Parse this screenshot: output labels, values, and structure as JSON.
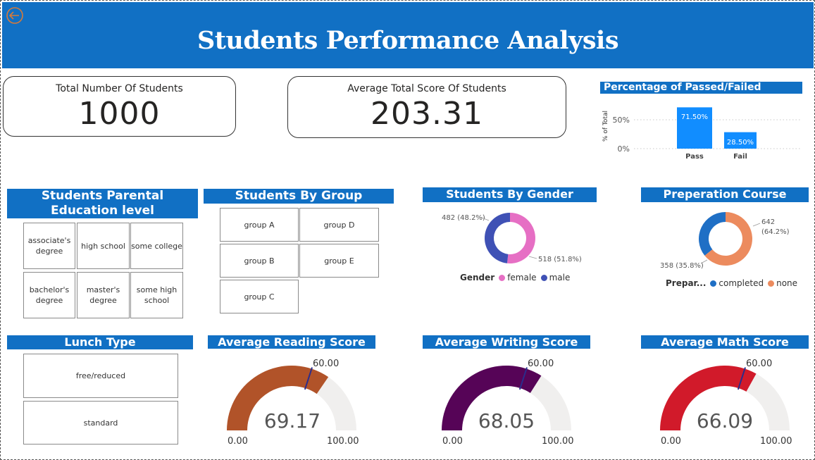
{
  "header": {
    "title": "Students Performance Analysis",
    "back_icon": "back-arrow-icon"
  },
  "kpis": {
    "total_students": {
      "label": "Total Number Of Students",
      "value": "1000"
    },
    "avg_total_score": {
      "label": "Average Total Score Of Students",
      "value": "203.31"
    }
  },
  "pass_fail": {
    "title": "Percentage of Passed/Failed Students",
    "y_axis_label": "% of Total",
    "y_ticks": [
      "50%",
      "0%"
    ],
    "bars": [
      {
        "category": "Pass",
        "label": "71.50%"
      },
      {
        "category": "Fail",
        "label": "28.50%"
      }
    ]
  },
  "parental_education": {
    "title": "Students Parental Education level",
    "items": [
      "associate's degree",
      "high school",
      "some college",
      "bachelor's degree",
      "master's degree",
      "some high school"
    ]
  },
  "groups": {
    "title": "Students By Group",
    "items": [
      "group A",
      "group D",
      "group B",
      "group E",
      "group C"
    ]
  },
  "gender": {
    "title": "Students By Gender",
    "legend_title": "Gender",
    "labels": {
      "male": "482 (48.2%)",
      "female": "518 (51.8%)"
    },
    "legend": [
      "female",
      "male"
    ]
  },
  "prep": {
    "title": "Preperation Course",
    "legend_title": "Prepar...",
    "labels": {
      "none_line1": "642",
      "none_line2": "(64.2%)",
      "completed": "358 (35.8%)"
    },
    "legend": [
      "completed",
      "none"
    ]
  },
  "lunch": {
    "title": "Lunch Type",
    "items": [
      "free/reduced",
      "standard"
    ]
  },
  "gauges": {
    "reading": {
      "title": "Average Reading Score",
      "value": "69.17",
      "target": "60.00",
      "min": "0.00",
      "max": "100.00"
    },
    "writing": {
      "title": "Average Writing Score",
      "value": "68.05",
      "target": "60.00",
      "min": "0.00",
      "max": "100.00"
    },
    "math": {
      "title": "Average Math Score",
      "value": "66.09",
      "target": "60.00",
      "min": "0.00",
      "max": "100.00"
    }
  },
  "chart_data": [
    {
      "type": "bar",
      "title": "Percentage of Passed/Failed Students",
      "ylabel": "% of Total",
      "categories": [
        "Pass",
        "Fail"
      ],
      "values": [
        71.5,
        28.5
      ],
      "ylim": [
        0,
        75
      ],
      "color": "#118dff"
    },
    {
      "type": "pie",
      "title": "Students By Gender",
      "categories": [
        "female",
        "male"
      ],
      "values": [
        518,
        482
      ],
      "colors": [
        "#e66fc4",
        "#3f51b5"
      ]
    },
    {
      "type": "pie",
      "title": "Preperation Course",
      "categories": [
        "completed",
        "none"
      ],
      "values": [
        358,
        642
      ],
      "colors": [
        "#1f6fc5",
        "#ec8b5e"
      ]
    },
    {
      "type": "gauge",
      "title": "Average Reading Score",
      "value": 69.17,
      "target": 60,
      "min": 0,
      "max": 100,
      "color": "#b15329"
    },
    {
      "type": "gauge",
      "title": "Average Writing Score",
      "value": 68.05,
      "target": 60,
      "min": 0,
      "max": 100,
      "color": "#560457"
    },
    {
      "type": "gauge",
      "title": "Average Math Score",
      "value": 66.09,
      "target": 60,
      "min": 0,
      "max": 100,
      "color": "#d11a2a"
    }
  ]
}
